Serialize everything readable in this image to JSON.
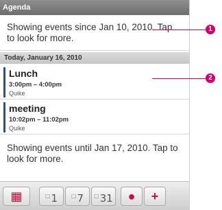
{
  "app": {
    "title": "Agenda"
  },
  "agenda": {
    "since_text": "Showing events since Jan 10, 2010. Tap to look for more.",
    "day_header": "Today, January 16, 2010",
    "events": [
      {
        "title": "Lunch",
        "time": "3:00pm – 4:00pm",
        "calendar": "Quike"
      },
      {
        "title": "meeting",
        "time": "10:02pm – 11:02pm",
        "calendar": "Quike"
      }
    ],
    "until_text": "Showing events until Jan 17, 2010. Tap to look for more."
  },
  "toolbar": {
    "day_num": "1",
    "week_num": "7",
    "month_num": "31"
  },
  "callouts": [
    "1",
    "2"
  ],
  "colors": {
    "accent": "#d6006a",
    "event_bar": "#2f4aa0",
    "titlebar": "#7d7d7d"
  }
}
